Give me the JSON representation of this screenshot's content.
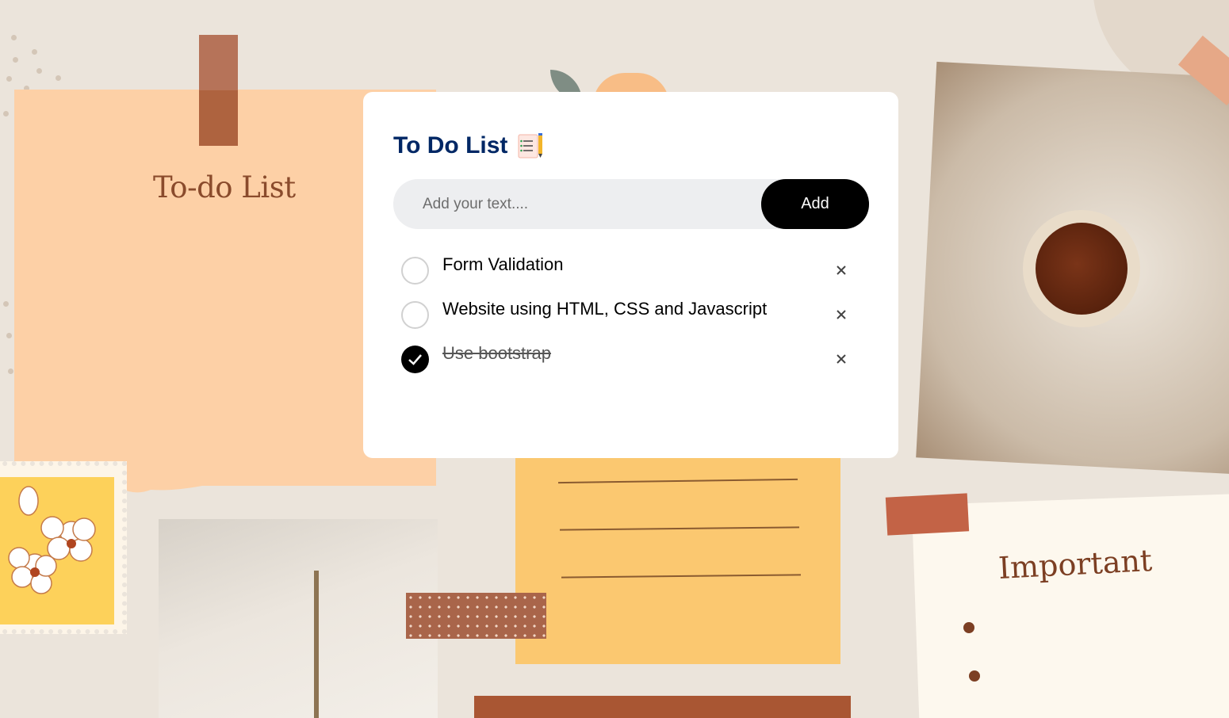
{
  "background": {
    "todo_note_label": "To-do List",
    "important_note_label": "Important"
  },
  "card": {
    "title": "To Do List",
    "title_icon": "notepad-checklist-icon",
    "input": {
      "placeholder": "Add your text....",
      "value": ""
    },
    "add_button_label": "Add",
    "items": [
      {
        "text": "Form Validation",
        "checked": false
      },
      {
        "text": "Website using HTML, CSS and Javascript",
        "checked": false
      },
      {
        "text": "Use bootstrap",
        "checked": true
      }
    ],
    "remove_icon": "close-icon"
  },
  "colors": {
    "title": "#002765",
    "button_bg": "#000000",
    "input_bg": "#edeef0",
    "page_bg": "#ebe4db",
    "peach_note": "#fdd0a6",
    "yellow_note": "#fbc870",
    "accent_brown": "#8a4b2c"
  }
}
